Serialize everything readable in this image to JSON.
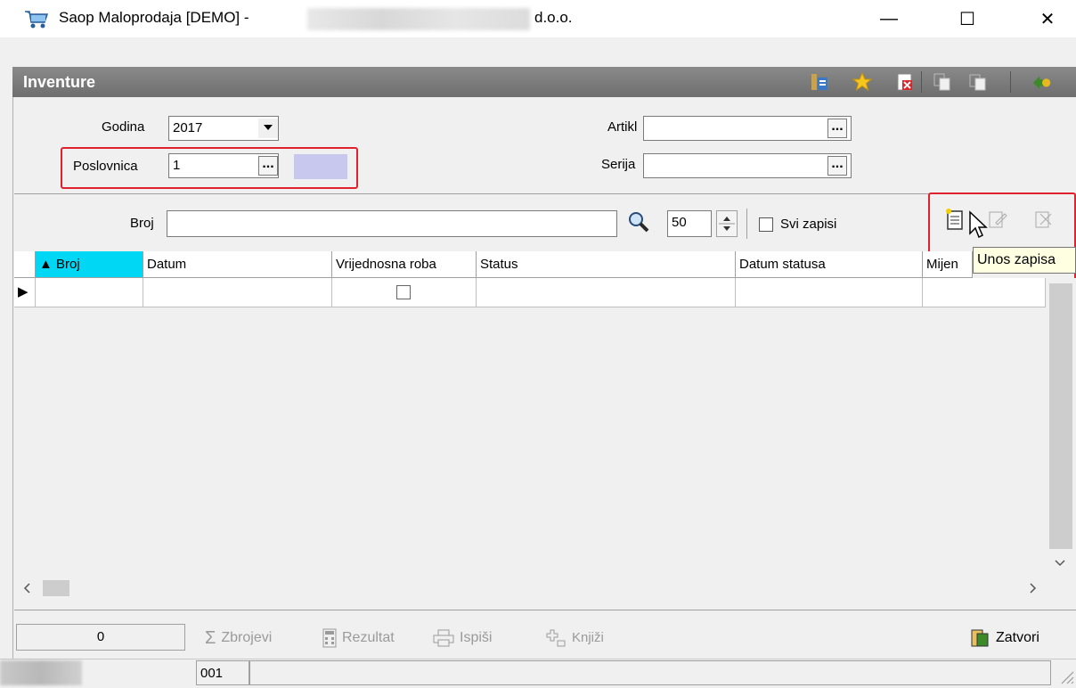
{
  "window": {
    "title_prefix": "Saop Maloprodaja [DEMO] -",
    "title_suffix": "d.o.o.",
    "minimize": "—",
    "maximize": "☐",
    "close": "✕"
  },
  "form": {
    "title": "Inventure",
    "toolbar_icons": [
      "columns-icon",
      "favorite-star-icon",
      "excel-export-icon",
      "copy-icon",
      "paste-icon",
      "exit-icon"
    ]
  },
  "filters": {
    "godina_label": "Godina",
    "godina_value": "2017",
    "poslovnica_label": "Poslovnica",
    "poslovnica_value": "1",
    "artikl_label": "Artikl",
    "artikl_value": "",
    "serija_label": "Serija",
    "serija_value": "",
    "dots": "..."
  },
  "search": {
    "broj_label": "Broj",
    "broj_value": "",
    "limit_value": "50",
    "svi_zapisi_label": "Svi zapisi"
  },
  "grid": {
    "columns": [
      "▲ Broj",
      "Datum",
      "Vrijednosna roba",
      "Status",
      "Datum statusa",
      "Mijen"
    ],
    "row_indicator": "▶"
  },
  "tooltip": "Unos zapisa",
  "bottom": {
    "count": "0",
    "zbrojevi": "Zbrojevi",
    "rezultat": "Rezultat",
    "ispisi": "Ispiši",
    "knjizi": "Knjiži",
    "zatvori": "Zatvori"
  },
  "statusbar": {
    "code": "001"
  },
  "colors": {
    "accent_red": "#e0212e",
    "header_gray": "#7a7a7a",
    "sorted_column": "#00d7f4"
  }
}
